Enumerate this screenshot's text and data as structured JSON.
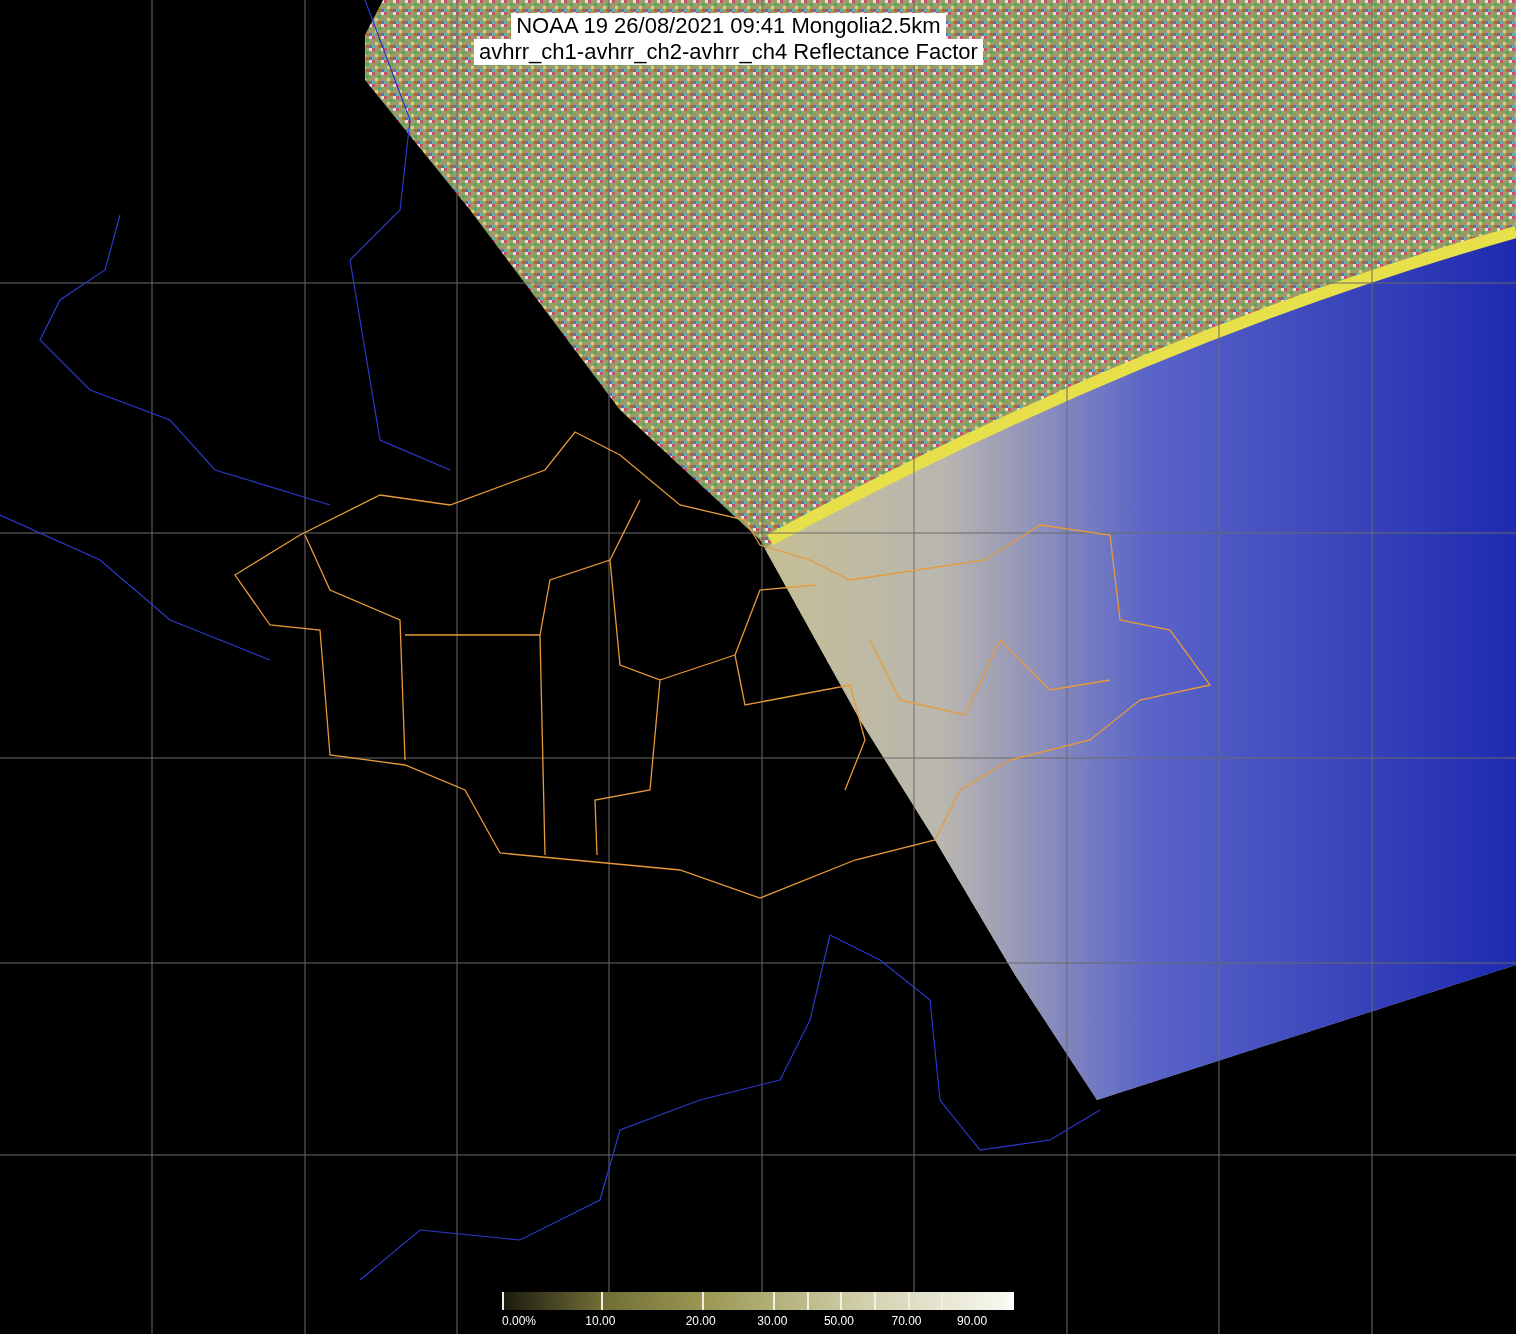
{
  "title": {
    "lines": [
      "NOAA 19 26/08/2021 09:41 Mongolia2.5km",
      "avhrr_ch1-avhrr_ch2-avhrr_ch4 Reflectance Factor"
    ]
  },
  "colorbar": {
    "labels": [
      "0.00%",
      "10.00",
      "20.00",
      "30.00",
      "50.00",
      "70.00",
      "90.00"
    ]
  }
}
